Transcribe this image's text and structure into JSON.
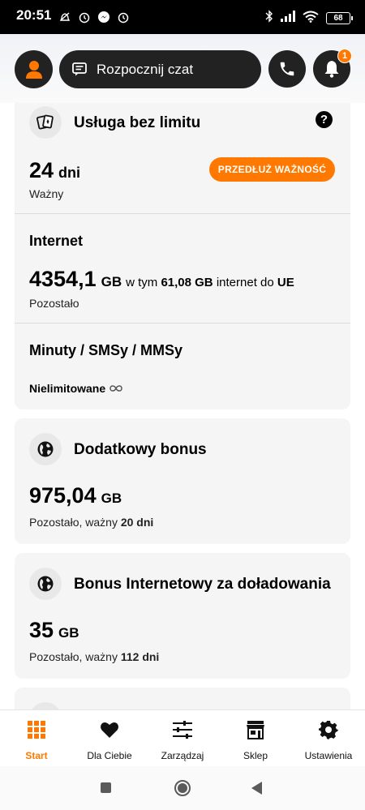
{
  "status_bar": {
    "time": "20:51",
    "battery": "68",
    "left_icons": [
      "do-not-disturb-icon",
      "alarm-icon",
      "messenger-icon",
      "alarm-icon"
    ],
    "right_icons": [
      "bluetooth-icon",
      "signal-icon",
      "wifi-icon",
      "battery-icon"
    ]
  },
  "header": {
    "chat_label": "Rozpocznij czat",
    "notification_count": "1",
    "accent": "#ff7900"
  },
  "service_card": {
    "title": "Usługa bez limitu",
    "validity_number": "24",
    "validity_unit": "dni",
    "validity_label": "Ważny",
    "extend_button": "PRZEDŁUŻ WAŻNOŚĆ",
    "internet": {
      "title": "Internet",
      "amount": "4354,1",
      "unit": "GB",
      "in_which": "w tym",
      "eu_amount": "61,08 GB",
      "eu_text": "internet do",
      "eu_region": "UE",
      "label": "Pozostało"
    },
    "minutes": {
      "title": "Minuty / SMSy / MMSy",
      "value": "Nielimitowane"
    }
  },
  "bonus_card": {
    "title": "Dodatkowy bonus",
    "amount": "975,04",
    "unit": "GB",
    "remaining_prefix": "Pozostało, ważny",
    "remaining_days": "20 dni"
  },
  "topup_card": {
    "title": "Bonus Internetowy za doładowania",
    "amount": "35",
    "unit": "GB",
    "remaining_prefix": "Pozostało, ważny",
    "remaining_days": "112 dni"
  },
  "bottom_nav": {
    "items": [
      {
        "label": "Start",
        "icon": "grid-icon",
        "active": true
      },
      {
        "label": "Dla Ciebie",
        "icon": "heart-icon",
        "active": false
      },
      {
        "label": "Zarządzaj",
        "icon": "sliders-icon",
        "active": false
      },
      {
        "label": "Sklep",
        "icon": "shop-icon",
        "active": false
      },
      {
        "label": "Ustawienia",
        "icon": "gear-icon",
        "active": false
      }
    ]
  }
}
